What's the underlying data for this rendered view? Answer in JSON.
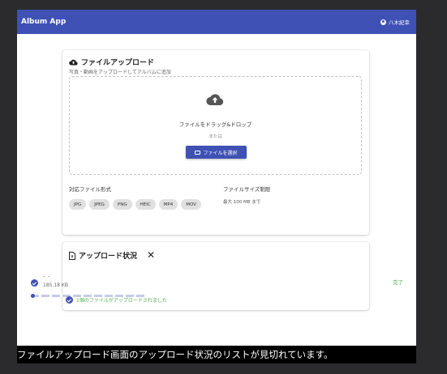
{
  "app": {
    "title": "Album App",
    "user_name": "八木紀幸",
    "brand_color": "#3f51b5"
  },
  "upload": {
    "title": "ファイルアップロード",
    "subtitle": "写真・動画をアップロードしてアルバムに追加",
    "drop_text": "ファイルをドラッグ&ドロップ",
    "or_text": "または",
    "select_button": "ファイルを選択",
    "formats_label": "対応ファイル形式",
    "formats": [
      "JPG",
      "JPEG",
      "PNG",
      "HEIC",
      "MP4",
      "MOV"
    ],
    "size_label": "ファイルサイズ制限",
    "size_value": "最大 100 MB まで"
  },
  "status": {
    "title": "アップロード状況",
    "file_name": "- -",
    "file_size": "185.18 KB",
    "file_status": "完了",
    "summary": "1個のファイルがアップロードされました",
    "success_color": "#4caf50"
  },
  "caption": "ファイルアップロード画面のアップロード状況のリストが見切れています。"
}
